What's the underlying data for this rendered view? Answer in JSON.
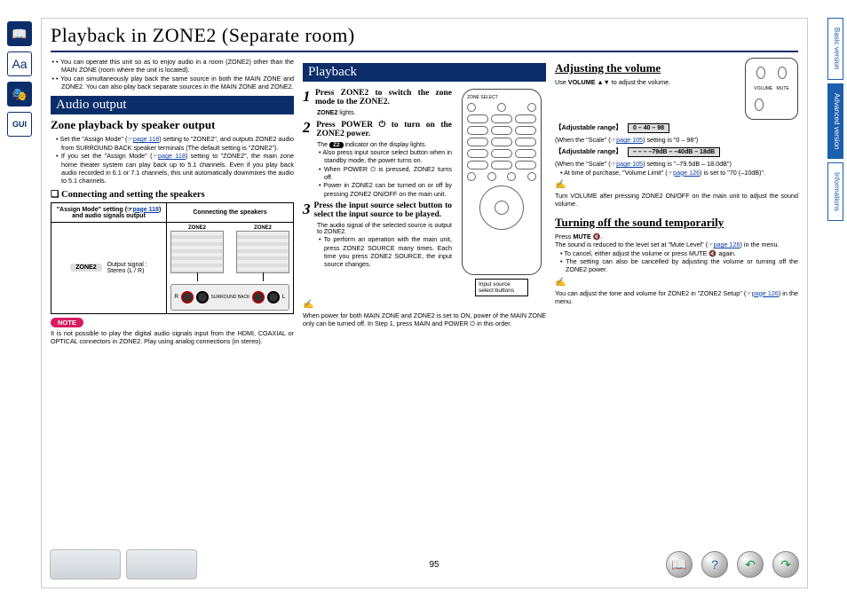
{
  "leftNav": {
    "book": "📖",
    "aa": "Aa",
    "mask": "😷",
    "gui": "GUI"
  },
  "title": "Playback in ZONE2 (Separate room)",
  "intro": [
    "You can operate this unit so as to enjoy audio in a room (ZONE2) other than the MAIN ZONE (room where the unit is located).",
    "You can simultaneously play back the same source in both the MAIN ZONE and ZONE2. You can also play back separate sources in the MAIN ZONE and ZONE2."
  ],
  "audio": {
    "bar": "Audio output",
    "sub1": "Zone playback by speaker output",
    "bullets1": [
      "Set the \"Assign Mode\" (☞page 118) setting to \"ZONE2\", and outputs ZONE2 audio from SURROUND BACK speaker terminals (The default setting is \"ZONE2\").",
      "If you set the \"Assign Mode\" (☞page 118) setting to \"ZONE2\", the main zone home theater system can play back up to 5.1 channels. Even if you play back audio recorded in 6.1 or 7.1 channels, this unit automatically downmixes the audio to 5.1 channels."
    ],
    "connHead": "Connecting and setting the speakers",
    "th1": "\"Assign Mode\" setting (☞page 118) and audio signals output",
    "th2": "Connecting the speakers",
    "z2": "ZONE2",
    "out": "Output signal :\nStereo (L / R)",
    "termLbls": {
      "r": "R",
      "l": "L",
      "z": "ZONE2",
      "sb": "SURROUND BACK"
    },
    "note": "NOTE",
    "noteText": "It is not possible to play the digital audio signals input from the HDMI, COAXIAL or OPTICAL connectors in ZONE2. Play using analog connections (in stereo)."
  },
  "playback": {
    "bar": "Playback",
    "s1": "Press ZONE2 to switch the zone mode to the ZONE2.",
    "s1b": "ZONE2 lights.",
    "s2": "Press POWER ⏻ to turn on the ZONE2 power.",
    "s2b1": "The Z2 indicator on the display lights.",
    "s2bul": [
      "Also press input source select button when in standby mode, the power turns on.",
      "When POWER ⏻ is pressed, ZONE2 turns off.",
      "Power in ZONE2 can be turned on or off by pressing ZONE2 ON/OFF on the main unit."
    ],
    "s3": "Press the input source select button to select the input source to be played.",
    "s3b": "The audio signal of the selected source is output to ZONE2.",
    "s3bul": [
      "To perform an operation with the main unit, press ZONE2 SOURCE many times. Each time you press ZONE2 SOURCE, the input source changes."
    ],
    "callout": "Input source select buttons",
    "foot": "When power for both MAIN ZONE and ZONE2 is set to ON, power of the MAIN ZONE only can be turned off. In Step 1, press MAIN and POWER ⏻ in this order."
  },
  "vol": {
    "h1": "Adjusting the volume",
    "t1": "Use VOLUME ▲▼ to adjust the volume.",
    "rangeLbl": "【Adjustable range】",
    "range1": "0 – 40 – 98",
    "range1sub": "(When the \"Scale\" (☞page 105) setting is \"0 – 98\")",
    "range2": "– – –  –79dB – –40dB – 18dB",
    "range2sub": "(When the \"Scale\" (☞page 105) setting is \"–79.5dB – 18.0dB\")",
    "range2b": "At time of purchase, \"Volume Limit\" (☞page 126) is set to \"70 (–10dB)\".",
    "hand1": "Turn VOLUME after pressing ZONE2 ON/OFF on the main unit to adjust the sound volume.",
    "h2": "Turning off the sound temporarily",
    "t2": "Press MUTE 🔇.",
    "t2b": "The sound is reduced to the level set at \"Mute Level\" (☞page 126) in the menu.",
    "t2bul": [
      "To cancel, either adjust the volume or press MUTE 🔇 again.",
      "The setting can also be cancelled by adjusting the volume or turning off the ZONE2 power."
    ],
    "foot": "You can adjust the tone and volume for ZONE2 in \"ZONE2 Setup\" (☞page 126) in the menu."
  },
  "tabs": {
    "basic": "Basic version",
    "adv": "Advanced version",
    "info": "Informations"
  },
  "pageNum": "95",
  "links": {
    "p118": "page 118",
    "p105": "page 105",
    "p126": "page 126"
  }
}
